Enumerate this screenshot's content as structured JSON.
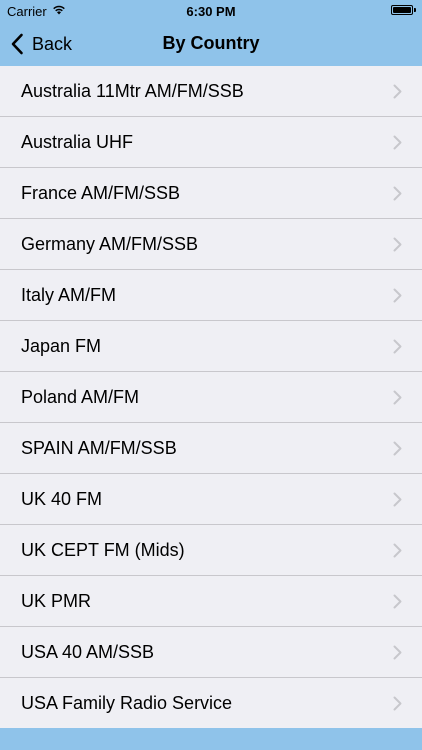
{
  "status_bar": {
    "carrier": "Carrier",
    "time": "6:30 PM",
    "battery_level": 1.0
  },
  "nav": {
    "back_label": "Back",
    "title": "By Country"
  },
  "colors": {
    "bar": "#8fc3ea",
    "background": "#efeff4",
    "separator": "#c8c7cc"
  },
  "items": [
    {
      "label": "Australia 11Mtr AM/FM/SSB"
    },
    {
      "label": "Australia UHF"
    },
    {
      "label": "France AM/FM/SSB"
    },
    {
      "label": "Germany AM/FM/SSB"
    },
    {
      "label": "Italy AM/FM"
    },
    {
      "label": "Japan FM"
    },
    {
      "label": "Poland AM/FM"
    },
    {
      "label": "SPAIN AM/FM/SSB"
    },
    {
      "label": "UK 40 FM"
    },
    {
      "label": "UK CEPT FM (Mids)"
    },
    {
      "label": "UK PMR"
    },
    {
      "label": "USA 40 AM/SSB"
    },
    {
      "label": "USA Family Radio Service"
    }
  ]
}
